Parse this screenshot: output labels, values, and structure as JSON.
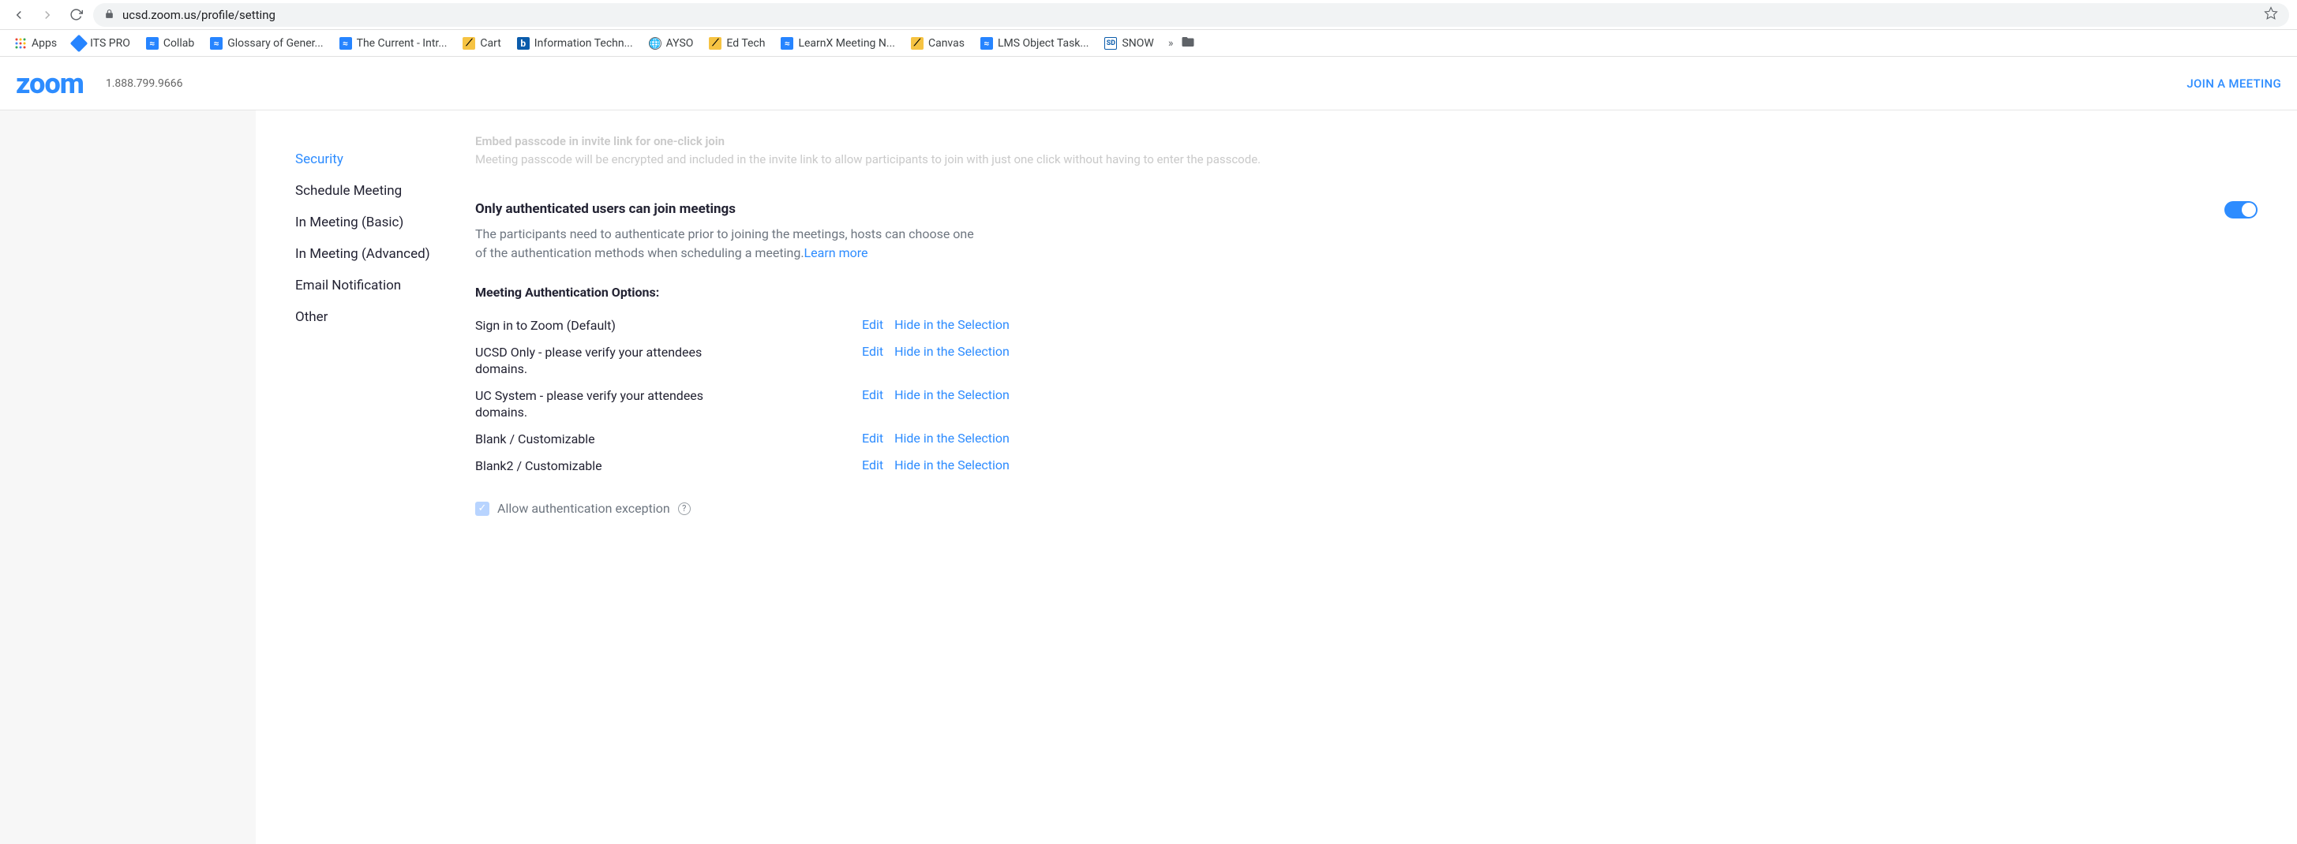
{
  "browser": {
    "url": "ucsd.zoom.us/profile/setting"
  },
  "bookmarks": {
    "apps": "Apps",
    "its": "ITS PRO",
    "collab": "Collab",
    "glossary": "Glossary of Gener...",
    "current": "The Current - Intr...",
    "cart": "Cart",
    "info": "Information Techn...",
    "ayso": "AYSO",
    "edtech": "Ed Tech",
    "learnx": "LearnX Meeting N...",
    "canvas": "Canvas",
    "lms": "LMS Object Task...",
    "snow": "SNOW",
    "more": "»"
  },
  "zoom": {
    "logo": "zoom",
    "phone": "1.888.799.9666",
    "join": "JOIN A MEETING"
  },
  "sidenav": {
    "security": "Security",
    "schedule": "Schedule Meeting",
    "basic": "In Meeting (Basic)",
    "advanced": "In Meeting (Advanced)",
    "email": "Email Notification",
    "other": "Other"
  },
  "faded": {
    "title": "Embed passcode in invite link for one-click join",
    "desc": "Meeting passcode will be encrypted and included in the invite link to allow participants to join with just one click without having to enter the passcode."
  },
  "setting": {
    "title": "Only authenticated users can join meetings",
    "desc": "The participants need to authenticate prior to joining the meetings, hosts can choose one of the authentication methods when scheduling a meeting.",
    "learn": "Learn more"
  },
  "auth": {
    "heading": "Meeting Authentication Options:",
    "edit": "Edit",
    "hide": "Hide in the Selection",
    "options": [
      "Sign in to Zoom (Default)",
      "UCSD Only - please verify your attendees domains.",
      "UC System - please verify your attendees domains.",
      "Blank / Customizable",
      "Blank2 / Customizable"
    ]
  },
  "checkbox": {
    "label": "Allow authentication exception"
  }
}
